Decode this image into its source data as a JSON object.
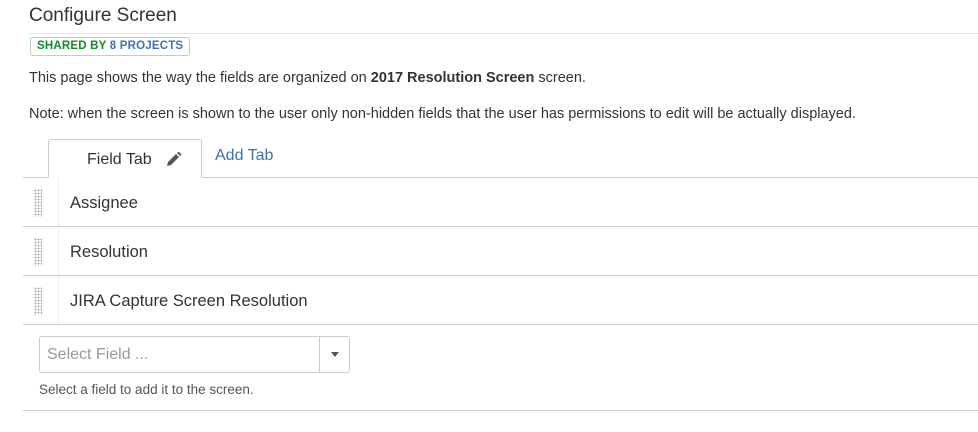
{
  "page": {
    "title": "Configure Screen",
    "shared_badge_prefix": "SHARED BY ",
    "shared_badge_link": "8 PROJECTS",
    "description_before": "This page shows the way the fields are organized on ",
    "description_screen_name": "2017 Resolution Screen",
    "description_after": " screen.",
    "note": "Note: when the screen is shown to the user only non-hidden fields that the user has permissions to edit will be actually displayed."
  },
  "tabs": {
    "active_label": "Field Tab",
    "add_label": "Add Tab"
  },
  "fields": [
    {
      "label": "Assignee"
    },
    {
      "label": "Resolution"
    },
    {
      "label": "JIRA Capture Screen Resolution"
    }
  ],
  "add_field": {
    "placeholder": "Select Field ...",
    "helper": "Select a field to add it to the screen."
  },
  "colors": {
    "link": "#3b73af",
    "badge_green": "#14892c",
    "border": "#cccccc"
  }
}
